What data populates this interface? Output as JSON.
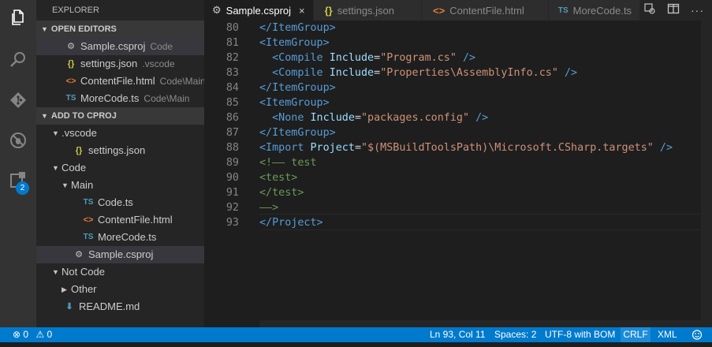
{
  "explorer": {
    "title": "EXPLORER",
    "open_editors": {
      "header": "OPEN EDITORS",
      "items": [
        {
          "name": "Sample.csproj",
          "desc": "Code"
        },
        {
          "name": "settings.json",
          "desc": ".vscode"
        },
        {
          "name": "ContentFile.html",
          "desc": "Code\\Main"
        },
        {
          "name": "MoreCode.ts",
          "desc": "Code\\Main"
        }
      ]
    },
    "project": {
      "header": "ADD TO CPROJ",
      "tree": [
        {
          "label": ".vscode"
        },
        {
          "label": "settings.json"
        },
        {
          "label": "Code"
        },
        {
          "label": "Main"
        },
        {
          "label": "Code.ts"
        },
        {
          "label": "ContentFile.html"
        },
        {
          "label": "MoreCode.ts"
        },
        {
          "label": "Sample.csproj"
        },
        {
          "label": "Not Code"
        },
        {
          "label": "Other"
        },
        {
          "label": "README.md"
        }
      ]
    }
  },
  "activity_badge": "2",
  "tabs": [
    {
      "label": "Sample.csproj",
      "icon": "gear-icon",
      "close": "×"
    },
    {
      "label": "settings.json",
      "icon": "braces-icon"
    },
    {
      "label": "ContentFile.html",
      "icon": "html-icon"
    },
    {
      "label": "MoreCode.ts",
      "icon": "ts-icon"
    }
  ],
  "editor": {
    "line_numbers": [
      "80",
      "81",
      "82",
      "83",
      "84",
      "85",
      "86",
      "87",
      "88",
      "89",
      "90",
      "91",
      "92",
      "93"
    ],
    "lines": [
      [
        {
          "t": "tag",
          "v": "</ItemGroup>"
        }
      ],
      [
        {
          "t": "tag",
          "v": "<ItemGroup>"
        }
      ],
      [
        {
          "t": "tag",
          "v": "  <Compile "
        },
        {
          "t": "attr",
          "v": "Include"
        },
        {
          "t": "txt",
          "v": "="
        },
        {
          "t": "str",
          "v": "\"Program.cs\""
        },
        {
          "t": "tag",
          "v": " />"
        }
      ],
      [
        {
          "t": "tag",
          "v": "  <Compile "
        },
        {
          "t": "attr",
          "v": "Include"
        },
        {
          "t": "txt",
          "v": "="
        },
        {
          "t": "str",
          "v": "\"Properties\\AssemblyInfo.cs\""
        },
        {
          "t": "tag",
          "v": " />"
        }
      ],
      [
        {
          "t": "tag",
          "v": "</ItemGroup>"
        }
      ],
      [
        {
          "t": "tag",
          "v": "<ItemGroup>"
        }
      ],
      [
        {
          "t": "tag",
          "v": "  <None "
        },
        {
          "t": "attr",
          "v": "Include"
        },
        {
          "t": "txt",
          "v": "="
        },
        {
          "t": "str",
          "v": "\"packages.config\""
        },
        {
          "t": "tag",
          "v": " />"
        }
      ],
      [
        {
          "t": "tag",
          "v": "</ItemGroup>"
        }
      ],
      [
        {
          "t": "tag",
          "v": "<Import "
        },
        {
          "t": "attr",
          "v": "Project"
        },
        {
          "t": "txt",
          "v": "="
        },
        {
          "t": "str",
          "v": "\"$(MSBuildToolsPath)\\Microsoft.CSharp.targets\""
        },
        {
          "t": "tag",
          "v": " />"
        }
      ],
      [
        {
          "t": "cmt",
          "v": "<!—— test"
        }
      ],
      [
        {
          "t": "cmt",
          "v": "<test>"
        }
      ],
      [
        {
          "t": "cmt",
          "v": "</test>"
        }
      ],
      [
        {
          "t": "cmt",
          "v": "——>"
        }
      ],
      [
        {
          "t": "tag",
          "v": "</Project>"
        }
      ]
    ]
  },
  "status": {
    "errors": "0",
    "warnings": "0",
    "position": "Ln 93, Col 11",
    "spaces": "Spaces: 2",
    "encoding": "UTF-8 with BOM",
    "eol": "CRLF",
    "language": "XML"
  }
}
